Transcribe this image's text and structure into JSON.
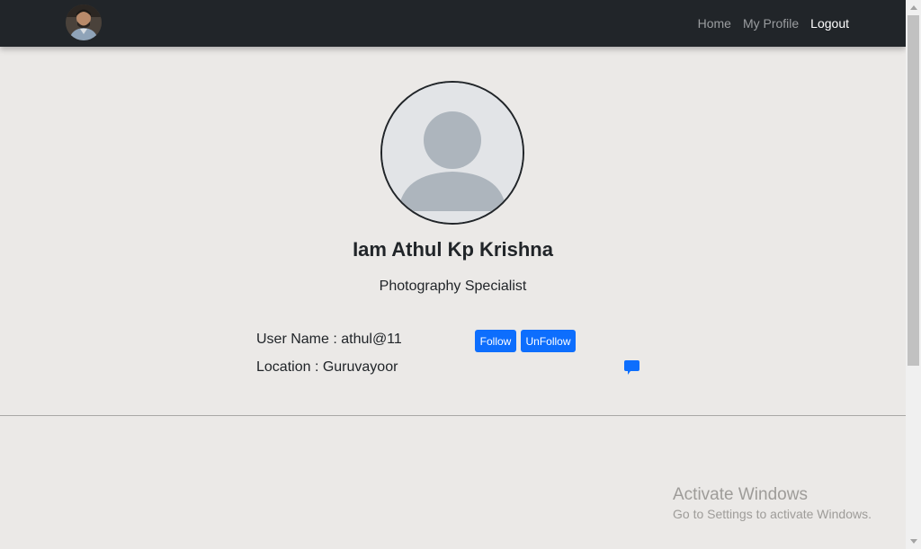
{
  "nav": {
    "links": [
      {
        "label": "Home"
      },
      {
        "label": "My Profile"
      },
      {
        "label": "Logout"
      }
    ]
  },
  "profile": {
    "name": "Iam Athul Kp Krishna",
    "role": "Photography Specialist",
    "username_line": "User Name : athul@11",
    "location_line": "Location : Guruvayoor"
  },
  "actions": {
    "follow_label": "Follow",
    "unfollow_label": "UnFollow"
  },
  "watermark": {
    "title": "Activate Windows",
    "subtitle": "Go to Settings to activate Windows."
  },
  "icons": {
    "chat": "chat-bubble-icon",
    "nav_avatar": "user-photo-avatar",
    "profile_avatar": "default-user-silhouette"
  },
  "colors": {
    "navbar": "#212529",
    "background": "#ebe9e7",
    "primary": "#0d6efd"
  }
}
